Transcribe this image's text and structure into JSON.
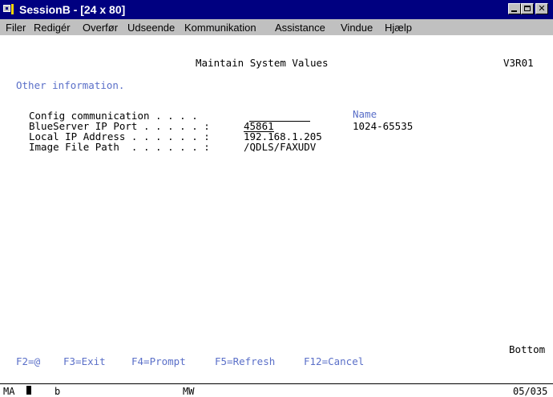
{
  "window": {
    "title": "SessionB - [24 x 80]",
    "colors": {
      "titlebar": "#000080",
      "chrome": "#c0c0c0",
      "field_label": "#5a6fc8"
    }
  },
  "menu": [
    "Filer",
    "Redigér",
    "Overfør",
    "Udseende",
    "Kommunikation",
    "Assistance",
    "Vindue",
    "Hjælp"
  ],
  "screen": {
    "heading": "Maintain System Values",
    "version": "V3R01",
    "section": "Other information.",
    "fields": [
      {
        "label": "Config communication . . . .",
        "value": "",
        "hint": "Name"
      },
      {
        "label": "BlueServer IP Port . . . . . :",
        "value": "45861",
        "hint": "1024-65535"
      },
      {
        "label": "Local IP Address . . . . . . :",
        "value": "192.168.1.205",
        "hint": ""
      },
      {
        "label": "Image File Path  . . . . . . :",
        "value": "/QDLS/FAXUDV",
        "hint": ""
      }
    ],
    "bottom": "Bottom",
    "function_keys": [
      "F2=@",
      "F3=Exit",
      "F4=Prompt",
      "F5=Refresh",
      "F12=Cancel"
    ]
  },
  "status": {
    "left": "MA",
    "mode": "b",
    "center": "MW",
    "position": "05/035"
  }
}
